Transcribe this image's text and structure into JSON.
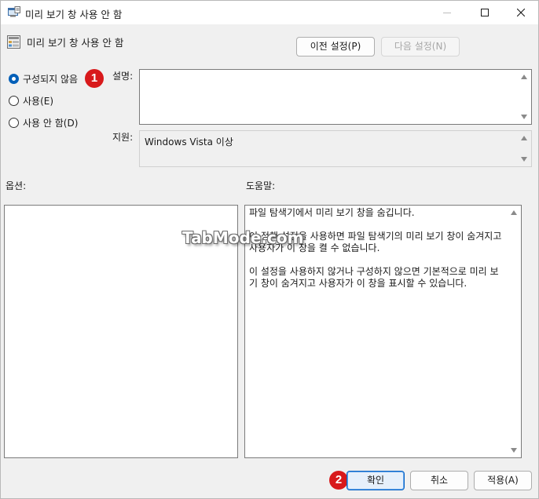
{
  "window": {
    "title": "미리 보기 창 사용 안 함",
    "app_icon": "policy-editor-icon",
    "controls": {
      "minimize": "minimize-icon",
      "maximize": "maximize-icon",
      "close": "close-icon"
    }
  },
  "header": {
    "title": "미리 보기 창 사용 안 함",
    "icon": "policy-setting-icon",
    "prev_label": "이전 설정(P)",
    "next_label": "다음 설정(N)"
  },
  "options": {
    "not_configured": "구성되지 않음",
    "enabled": "사용(E)",
    "disabled": "사용 안 함(D)",
    "selected": "not_configured"
  },
  "labels": {
    "comment": "설명:",
    "supported": "지원:",
    "options": "옵션:",
    "help": "도움말:"
  },
  "supported_value": "Windows Vista 이상",
  "help_text": "파일 탐색기에서 미리 보기 창을 숨깁니다.\n\n이 정책 설정을 사용하면 파일 탐색기의 미리 보기 창이 숨겨지고 사용자가 이 창을 켤 수 없습니다.\n\n이 설정을 사용하지 않거나 구성하지 않으면 기본적으로 미리 보기 창이 숨겨지고 사용자가 이 창을 표시할 수 있습니다.",
  "watermark": "TabMode.com",
  "badges": {
    "first": "1",
    "second": "2"
  },
  "footer": {
    "ok_label": "확인",
    "cancel_label": "취소",
    "apply_label": "적용(A)"
  },
  "colors": {
    "accent": "#005fb8",
    "badge": "#d8191b"
  }
}
